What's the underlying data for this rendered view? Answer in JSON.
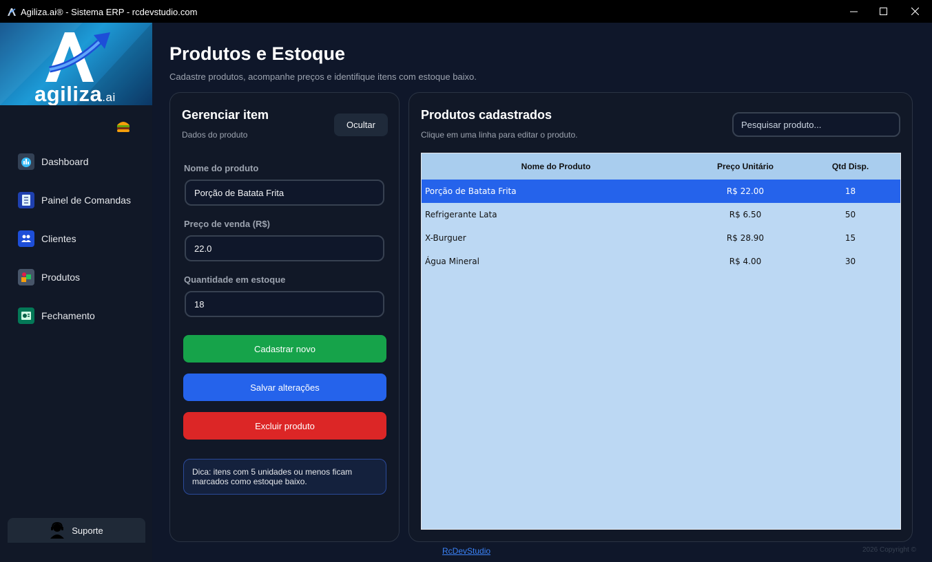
{
  "window": {
    "title": "Agiliza.ai® - Sistema ERP - rcdevstudio.com"
  },
  "sidebar": {
    "logo_text": "agiliza",
    "logo_suffix": ".ai",
    "items": [
      {
        "label": "Dashboard",
        "icon": "dashboard-icon"
      },
      {
        "label": "Painel de Comandas",
        "icon": "orders-panel-icon"
      },
      {
        "label": "Clientes",
        "icon": "clients-icon"
      },
      {
        "label": "Produtos",
        "icon": "products-icon"
      },
      {
        "label": "Fechamento",
        "icon": "closing-icon"
      }
    ],
    "support_label": "Suporte"
  },
  "page": {
    "title": "Produtos e Estoque",
    "subtitle": "Cadastre produtos, acompanhe preços e identifique itens com estoque baixo."
  },
  "form": {
    "title": "Gerenciar item",
    "subtitle": "Dados do produto",
    "hide_label": "Ocultar",
    "name_label": "Nome do produto",
    "name_value": "Porção de Batata Frita",
    "price_label": "Preço de venda (R$)",
    "price_value": "22.0",
    "qty_label": "Quantidade em estoque",
    "qty_value": "18",
    "btn_new": "Cadastrar novo",
    "btn_save": "Salvar alterações",
    "btn_delete": "Excluir produto",
    "tip_line1": "Dica: itens com 5 unidades ou menos ficam",
    "tip_line2": "marcados como estoque baixo."
  },
  "list": {
    "title": "Produtos cadastrados",
    "subtitle": "Clique em uma linha para editar o produto.",
    "search_placeholder": "Pesquisar produto...",
    "columns": [
      "Nome do Produto",
      "Preço Unitário",
      "Qtd Disp."
    ],
    "rows": [
      {
        "name": "Porção de Batata Frita",
        "price": "R$ 22.00",
        "qty": "18"
      },
      {
        "name": "Refrigerante Lata",
        "price": "R$ 6.50",
        "qty": "50"
      },
      {
        "name": "X-Burguer",
        "price": "R$ 28.90",
        "qty": "15"
      },
      {
        "name": "Água Mineral",
        "price": "R$ 4.00",
        "qty": "30"
      }
    ],
    "selected_index": 0
  },
  "footer": {
    "link": "RcDevStudio",
    "copyright": "2026 Copyright ©"
  },
  "colors": {
    "accent_blue": "#2563eb",
    "success_green": "#16a34a",
    "danger_red": "#dc2626",
    "background": "#0f172a"
  }
}
